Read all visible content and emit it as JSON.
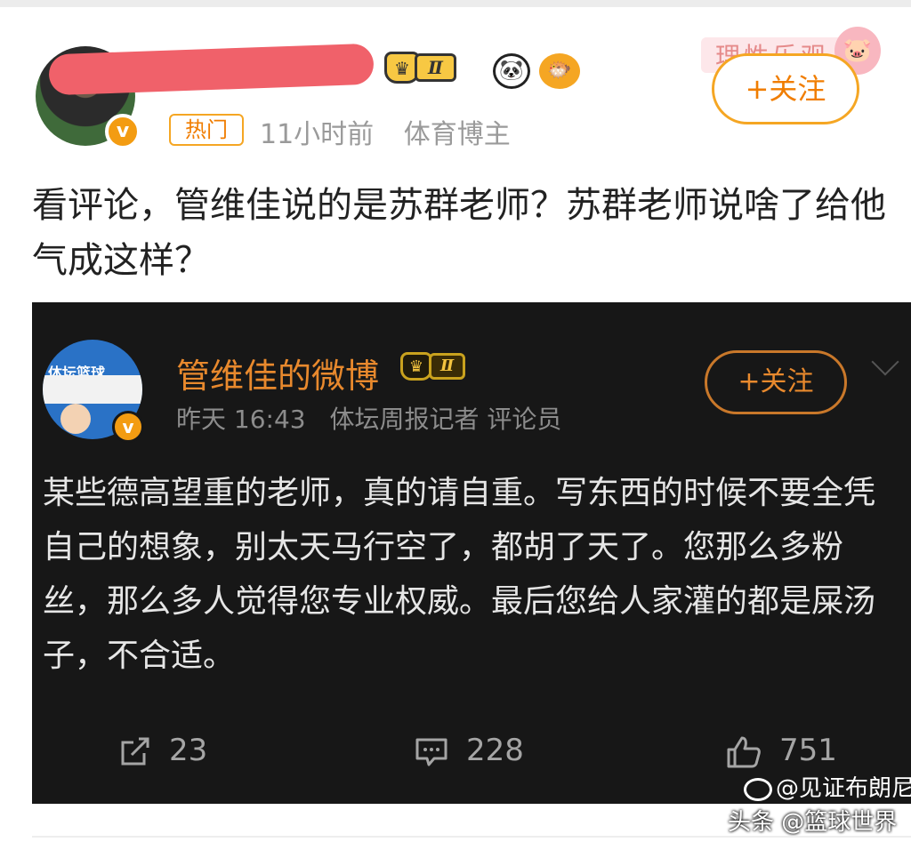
{
  "outer_post": {
    "level_badge": "Ⅱ",
    "verified_mark": "v",
    "follow_label": "+关注",
    "hot_tag": "热门",
    "time": "11小时前",
    "role": "体育博主",
    "sticker_text": "理性乐观",
    "text": "看评论，管维佳说的是苏群老师？苏群老师说啥了给他气成这样？",
    "colors": {
      "accent": "#f07d00",
      "redaction": "#f0616a"
    }
  },
  "embedded_post": {
    "avatar_text": "体坛篮球",
    "verified_mark": "v",
    "author": "管维佳的微博",
    "level_badge": "Ⅱ",
    "follow_label": "+关注",
    "time": "昨天 16:43",
    "role": "体坛周报记者 评论员",
    "text": "某些德高望重的老师，真的请自重。写东西的时候不要全凭自己的想象，别太天马行空了，都胡了天了。您那么多粉丝，那么多人觉得您专业权威。最后您给人家灌的都是屎汤子，不合适。",
    "actions": {
      "repost_count": "23",
      "comment_count": "228",
      "like_count": "751"
    },
    "colors": {
      "background": "#171717",
      "name": "#e8892d"
    }
  },
  "watermarks": {
    "weibo": "@见证布朗尼",
    "toutiao": "头条 @篮球世界"
  }
}
